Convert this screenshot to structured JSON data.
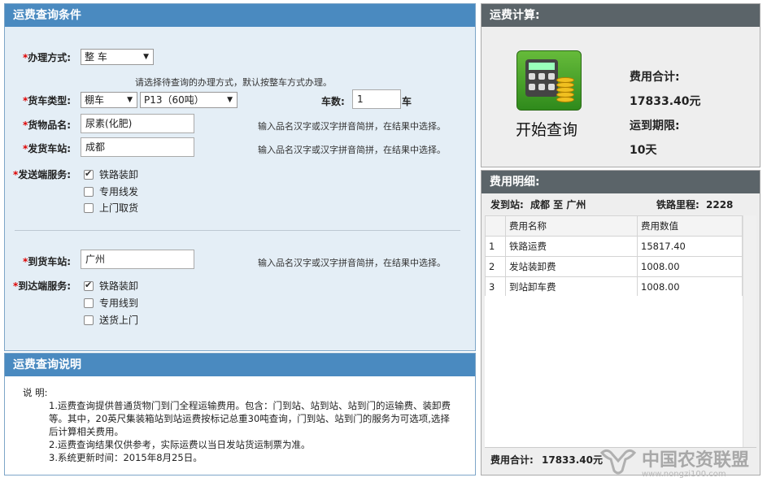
{
  "left_header": "运费查询条件",
  "form": {
    "method_label": "办理方式:",
    "method_value": "整 车",
    "method_hint": "请选择待查询的办理方式，默认按整车方式办理。",
    "car_type_label": "货车类型:",
    "car_type_value": "棚车",
    "car_model_value": "P13（60吨）",
    "car_count_label": "车数:",
    "car_count_value": "1",
    "car_unit": "车",
    "goods_label": "货物品名:",
    "goods_value": "尿素(化肥)",
    "goods_hint": "输入品名汉字或汉字拼音简拼，在结果中选择。",
    "from_label": "发货车站:",
    "from_value": "成都",
    "from_hint": "输入品名汉字或汉字拼音简拼，在结果中选择。",
    "send_service_label": "发送端服务:",
    "send_services": [
      {
        "label": "铁路装卸",
        "checked": true
      },
      {
        "label": "专用线发",
        "checked": false
      },
      {
        "label": "上门取货",
        "checked": false
      }
    ],
    "to_label": "到货车站:",
    "to_value": "广州",
    "to_hint": "输入品名汉字或汉字拼音简拼，在结果中选择。",
    "arrive_service_label": "到达端服务:",
    "arrive_services": [
      {
        "label": "铁路装卸",
        "checked": true
      },
      {
        "label": "专用线到",
        "checked": false
      },
      {
        "label": "送货上门",
        "checked": false
      }
    ]
  },
  "desc_header": "运费查询说明",
  "desc": {
    "title": "说  明:",
    "line1": "1.运费查询提供普通货物门到门全程运输费用。包含：门到站、站到站、站到门的运输费、装卸费等。其中，20英尺集装箱站到站运费按标记总重30吨查询，门到站、站到门的服务为可选项,选择后计算相关费用。",
    "line2": "2.运费查询结果仅供参考，实际运费以当日发站货运制票为准。",
    "line3": "3.系统更新时间：2015年8月25日。"
  },
  "calc": {
    "header": "运费计算:",
    "start_label": "开始查询",
    "total_label": "费用合计:",
    "total_value": "17833.40元",
    "period_label": "运到期限:",
    "period_value": "10天"
  },
  "detail": {
    "header": "费用明细:",
    "route_label": "发到站:",
    "route_value": "成都 至 广州",
    "distance_label": "铁路里程:",
    "distance_value": "2228",
    "columns": [
      "费用名称",
      "费用数值"
    ],
    "rows": [
      {
        "no": "1",
        "name": "铁路运费",
        "value": "15817.40"
      },
      {
        "no": "2",
        "name": "发站装卸费",
        "value": "1008.00"
      },
      {
        "no": "3",
        "name": "到站卸车费",
        "value": "1008.00"
      }
    ],
    "footer_label": "费用合计:",
    "footer_value": "17833.40元"
  },
  "watermark": {
    "cn": "中国农资联盟",
    "url": "www.nongzi100.com"
  }
}
